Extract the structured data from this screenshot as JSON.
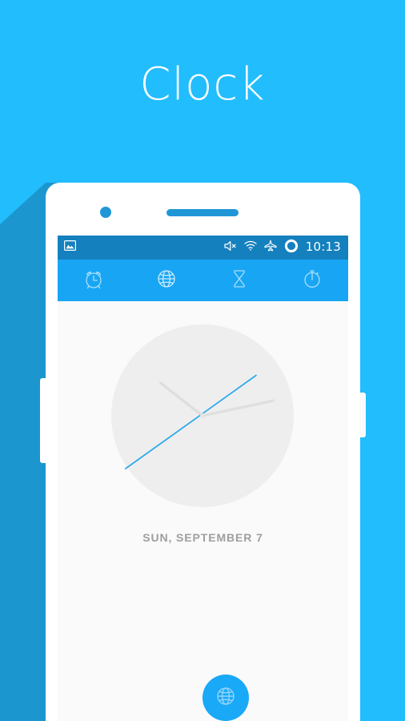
{
  "hero": {
    "title": "Clock",
    "background_color": "#22bdfd",
    "title_color": "#ffffff"
  },
  "device": {
    "body_color": "#ffffff",
    "shadow_color": "#1c96ce",
    "accent_color": "#2196d6",
    "camera_label": "front-camera",
    "speaker_label": "earpiece-speaker"
  },
  "screen": {
    "background_color": "#fafafa",
    "status_bar": {
      "background_color": "#1580be",
      "time": "10:13",
      "left_icons": [
        {
          "name": "image-icon",
          "label": "Screenshot captured"
        }
      ],
      "right_icons": [
        {
          "name": "volume-mute-icon",
          "label": "Sound muted"
        },
        {
          "name": "wifi-icon",
          "label": "Wi-Fi connected"
        },
        {
          "name": "airplane-mode-icon",
          "label": "Airplane mode"
        },
        {
          "name": "battery-circle-icon",
          "label": "Battery"
        }
      ]
    },
    "tab_bar": {
      "background_color": "#18a6f4",
      "icon_color": "#a9dffc",
      "tabs": [
        {
          "name": "tab-alarm",
          "icon": "alarm-clock-icon",
          "label": "Alarm"
        },
        {
          "name": "tab-world-clock",
          "icon": "globe-icon",
          "label": "World clock"
        },
        {
          "name": "tab-timer",
          "icon": "hourglass-icon",
          "label": "Timer"
        },
        {
          "name": "tab-stopwatch",
          "icon": "stopwatch-icon",
          "label": "Stopwatch"
        }
      ],
      "selected_index": 1
    },
    "clock": {
      "face_color": "#eeeeee",
      "hand_color": "#dcdcdc",
      "second_hand_color": "#2aa9ee",
      "time": "10:13",
      "hour_angle_deg": 307,
      "minute_angle_deg": 78,
      "second_angle_deg": 61,
      "date_text": "SUN, SEPTEMBER 7",
      "date_color": "#9e9e9e"
    },
    "fab": {
      "name": "add-world-clock-button",
      "icon": "globe-icon",
      "background_color": "#19a9f7",
      "icon_color": "#8fd4fb",
      "label": "Add city"
    }
  }
}
